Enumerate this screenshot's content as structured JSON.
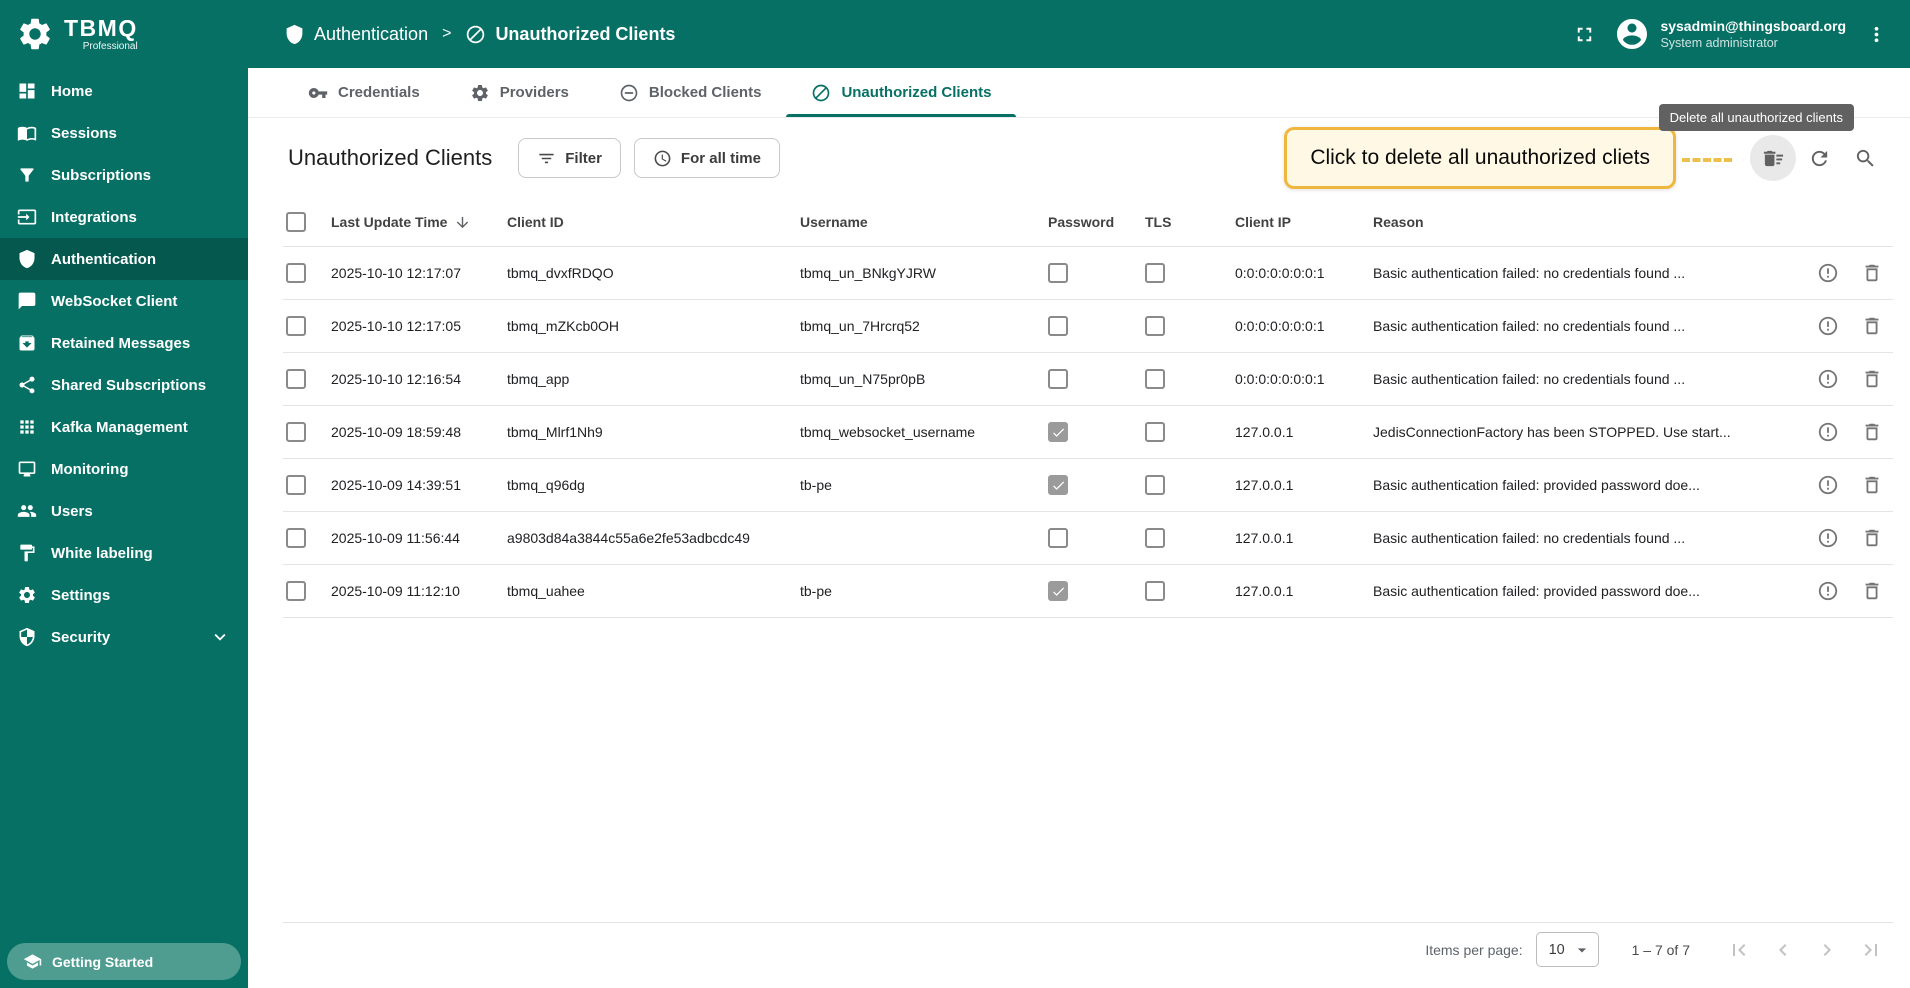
{
  "colors": {
    "primary": "#077065",
    "sidebar_active": "#04584E",
    "getting_started_bg": "#4E9D90",
    "callout_border": "#F0B73F",
    "callout_bg": "#FFF8E4",
    "tooltip_bg": "#616161"
  },
  "brand": {
    "name": "TBMQ",
    "subtitle": "Professional"
  },
  "header": {
    "separator": ">",
    "breadcrumb": [
      {
        "label": "Authentication",
        "icon": "shield-icon"
      },
      {
        "label": "Unauthorized Clients",
        "icon": "block-icon"
      }
    ],
    "user": {
      "email": "sysadmin@thingsboard.org",
      "role": "System administrator"
    }
  },
  "sidebar": {
    "items": [
      {
        "label": "Home",
        "icon": "dashboard-icon",
        "active": false
      },
      {
        "label": "Sessions",
        "icon": "book-icon",
        "active": false
      },
      {
        "label": "Subscriptions",
        "icon": "funnel-icon",
        "active": false
      },
      {
        "label": "Integrations",
        "icon": "input-icon",
        "active": false
      },
      {
        "label": "Authentication",
        "icon": "shield-icon",
        "active": true
      },
      {
        "label": "WebSocket Client",
        "icon": "chat-icon",
        "active": false
      },
      {
        "label": "Retained Messages",
        "icon": "archive-icon",
        "active": false
      },
      {
        "label": "Shared Subscriptions",
        "icon": "share-icon",
        "active": false
      },
      {
        "label": "Kafka Management",
        "icon": "apps-grid-icon",
        "active": false
      },
      {
        "label": "Monitoring",
        "icon": "monitor-icon",
        "active": false
      },
      {
        "label": "Users",
        "icon": "people-icon",
        "active": false
      },
      {
        "label": "White labeling",
        "icon": "paint-icon",
        "active": false
      },
      {
        "label": "Settings",
        "icon": "gear-icon",
        "active": false
      },
      {
        "label": "Security",
        "icon": "security-shield-icon",
        "active": false,
        "expandable": true
      }
    ],
    "getting_started": "Getting Started"
  },
  "tabs": [
    {
      "label": "Credentials",
      "icon": "key-icon",
      "active": false
    },
    {
      "label": "Providers",
      "icon": "gear-icon",
      "active": false
    },
    {
      "label": "Blocked Clients",
      "icon": "minus-circle-icon",
      "active": false
    },
    {
      "label": "Unauthorized Clients",
      "icon": "block-icon",
      "active": true
    }
  ],
  "toolbar": {
    "title": "Unauthorized Clients",
    "filter_label": "Filter",
    "time_range_label": "For all time"
  },
  "callout": {
    "text": "Click to delete all unauthorized cliets"
  },
  "tooltip": {
    "text": "Delete all unauthorized clients"
  },
  "table": {
    "columns": {
      "time": "Last Update Time",
      "client_id": "Client ID",
      "username": "Username",
      "password": "Password",
      "tls": "TLS",
      "client_ip": "Client IP",
      "reason": "Reason"
    },
    "rows": [
      {
        "time": "2025-10-10 12:17:07",
        "client_id": "tbmq_dvxfRDQO",
        "username": "tbmq_un_BNkgYJRW",
        "password": false,
        "tls": false,
        "client_ip": "0:0:0:0:0:0:0:1",
        "reason": "Basic authentication failed: no credentials found ..."
      },
      {
        "time": "2025-10-10 12:17:05",
        "client_id": "tbmq_mZKcb0OH",
        "username": "tbmq_un_7Hrcrq52",
        "password": false,
        "tls": false,
        "client_ip": "0:0:0:0:0:0:0:1",
        "reason": "Basic authentication failed: no credentials found ..."
      },
      {
        "time": "2025-10-10 12:16:54",
        "client_id": "tbmq_app",
        "username": "tbmq_un_N75pr0pB",
        "password": false,
        "tls": false,
        "client_ip": "0:0:0:0:0:0:0:1",
        "reason": "Basic authentication failed: no credentials found ..."
      },
      {
        "time": "2025-10-09 18:59:48",
        "client_id": "tbmq_Mlrf1Nh9",
        "username": "tbmq_websocket_username",
        "password": true,
        "tls": false,
        "client_ip": "127.0.0.1",
        "reason": "JedisConnectionFactory has been STOPPED. Use start..."
      },
      {
        "time": "2025-10-09 14:39:51",
        "client_id": "tbmq_q96dg",
        "username": "tb-pe",
        "password": true,
        "tls": false,
        "client_ip": "127.0.0.1",
        "reason": "Basic authentication failed: provided password doe..."
      },
      {
        "time": "2025-10-09 11:56:44",
        "client_id": "a9803d84a3844c55a6e2fe53adbcdc49",
        "username": "",
        "password": false,
        "tls": false,
        "client_ip": "127.0.0.1",
        "reason": "Basic authentication failed: no credentials found ..."
      },
      {
        "time": "2025-10-09 11:12:10",
        "client_id": "tbmq_uahee",
        "username": "tb-pe",
        "password": true,
        "tls": false,
        "client_ip": "127.0.0.1",
        "reason": "Basic authentication failed: provided password doe..."
      }
    ]
  },
  "footer": {
    "items_per_page_label": "Items per page:",
    "items_per_page_value": "10",
    "range_label": "1 – 7 of 7"
  }
}
